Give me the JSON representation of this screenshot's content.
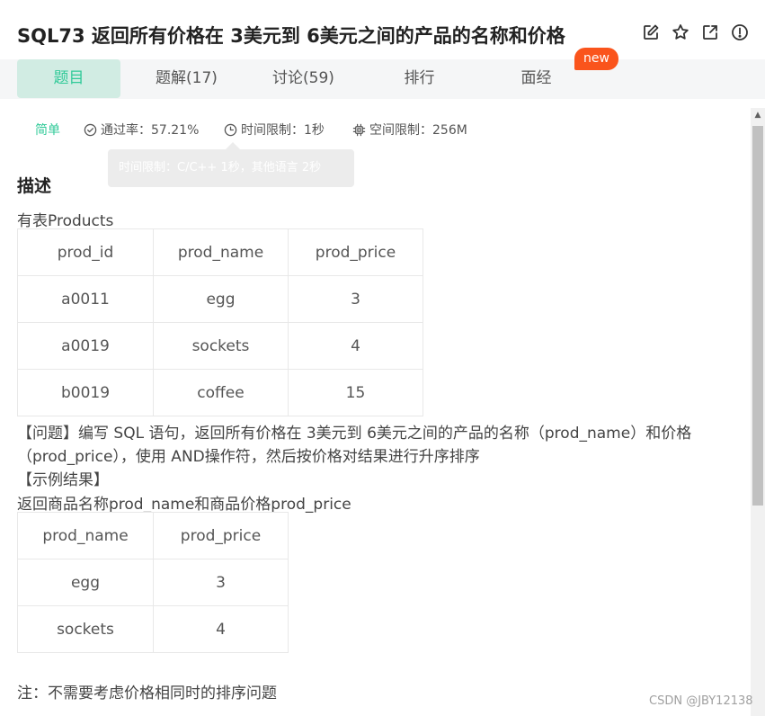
{
  "header": {
    "title": "SQL73  返回所有价格在 3美元到 6美元之间的产品的名称和价格",
    "icons": [
      "edit-icon",
      "star-icon",
      "external-link-icon",
      "info-icon"
    ]
  },
  "tabs": [
    {
      "label": "题目",
      "active": true
    },
    {
      "label": "题解(17)",
      "active": false
    },
    {
      "label": "讨论(59)",
      "active": false
    },
    {
      "label": "排行",
      "active": false
    },
    {
      "label": "面经",
      "active": false
    }
  ],
  "badge_new": "new",
  "meta": {
    "difficulty": "简单",
    "pass_rate": "通过率：57.21%",
    "time_limit": "时间限制：1秒",
    "memory_limit": "空间限制：256M"
  },
  "tooltip": "时间限制：C/C++ 1秒，其他语言 2秒",
  "description": {
    "heading": "描述",
    "table_intro": "有表Products",
    "products_table": {
      "headers": [
        "prod_id",
        "prod_name",
        "prod_price"
      ],
      "rows": [
        [
          "a0011",
          "egg",
          "3"
        ],
        [
          "a0019",
          "sockets",
          "4"
        ],
        [
          "b0019",
          "coffee",
          "15"
        ]
      ]
    },
    "question_line1": "【问题】编写 SQL 语句，返回所有价格在 3美元到 6美元之间的产品的名称（prod_name）和价格",
    "question_line2": "（prod_price），使用 AND操作符，然后按价格对结果进行升序排序",
    "example_heading": "【示例结果】",
    "example_intro": "返回商品名称prod_name和商品价格prod_price",
    "result_table": {
      "headers": [
        "prod_name",
        "prod_price"
      ],
      "rows": [
        [
          "egg",
          "3"
        ],
        [
          "sockets",
          "4"
        ]
      ]
    },
    "note": "注：不需要考虑价格相同时的排序问题"
  },
  "watermark": "CSDN @JBY12138",
  "colors": {
    "accent": "#32ca99",
    "active_tab_bg": "#d1ece3",
    "badge": "#fa541c"
  }
}
